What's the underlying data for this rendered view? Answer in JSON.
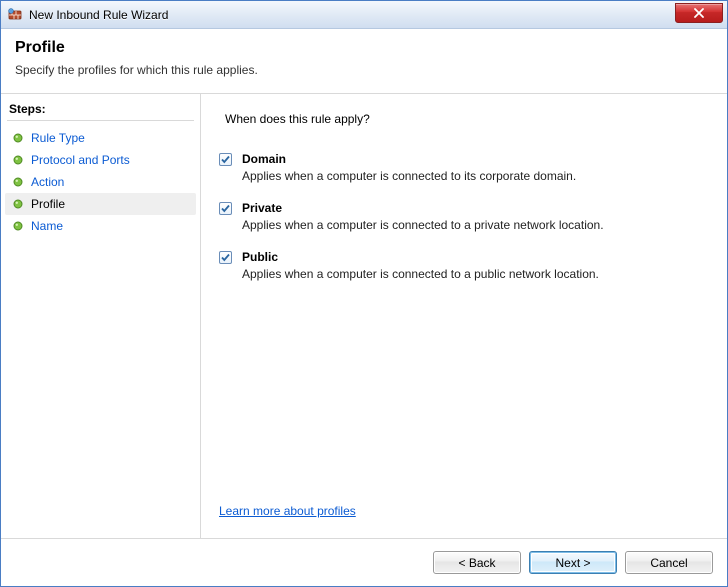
{
  "titlebar": {
    "title": "New Inbound Rule Wizard"
  },
  "header": {
    "title": "Profile",
    "subtitle": "Specify the profiles for which this rule applies."
  },
  "sidebar": {
    "title": "Steps:",
    "items": [
      {
        "label": "Rule Type",
        "current": false
      },
      {
        "label": "Protocol and Ports",
        "current": false
      },
      {
        "label": "Action",
        "current": false
      },
      {
        "label": "Profile",
        "current": true
      },
      {
        "label": "Name",
        "current": false
      }
    ]
  },
  "main": {
    "question": "When does this rule apply?",
    "options": [
      {
        "label": "Domain",
        "checked": true,
        "desc": "Applies when a computer is connected to its corporate domain."
      },
      {
        "label": "Private",
        "checked": true,
        "desc": "Applies when a computer is connected to a private network location."
      },
      {
        "label": "Public",
        "checked": true,
        "desc": "Applies when a computer is connected to a public network location."
      }
    ],
    "learn_more": "Learn more about profiles"
  },
  "footer": {
    "back": "< Back",
    "next": "Next >",
    "cancel": "Cancel"
  }
}
